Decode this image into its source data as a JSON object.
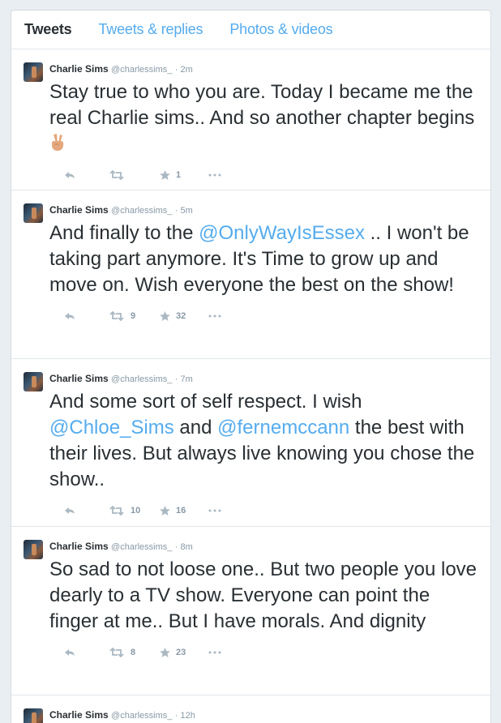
{
  "tabs": {
    "tweets": "Tweets",
    "replies": "Tweets & replies",
    "media": "Photos & videos"
  },
  "tweets": [
    {
      "name": "Charlie Sims",
      "handle": "@charlessims_",
      "time": "· 2m",
      "text": "Stay true to who you are. Today I became me the real Charlie sims.. And so another chapter begins",
      "retweets": "",
      "favorites": "1"
    },
    {
      "name": "Charlie Sims",
      "handle": "@charlessims_",
      "time": "· 5m",
      "text_before": "And finally to the ",
      "mention1": "@OnlyWayIsEssex",
      "text_after": " .. I won't be taking part anymore. It's Time to grow up and move on. Wish everyone the best on the show!",
      "retweets": "9",
      "favorites": "32"
    },
    {
      "name": "Charlie Sims",
      "handle": "@charlessims_",
      "time": "· 7m",
      "text_before": "And some sort of self respect. I wish ",
      "mention1": "@Chloe_Sims",
      "text_middle": " and ",
      "mention2": "@fernemccann",
      "text_after": " the best with their lives. But always live knowing you chose the show..",
      "retweets": "10",
      "favorites": "16"
    },
    {
      "name": "Charlie Sims",
      "handle": "@charlessims_",
      "time": "· 8m",
      "text": "So sad to not loose one.. But two people you love dearly to a TV show. Everyone can point the finger at me.. But I have morals. And dignity",
      "retweets": "8",
      "favorites": "23"
    },
    {
      "name": "Charlie Sims",
      "handle": "@charlessims_",
      "time": "· 12h"
    }
  ],
  "icons": {
    "reply": "reply-icon",
    "retweet": "retweet-icon",
    "favorite": "star-icon",
    "more": "more-icon",
    "emoji": "victory-hand-emoji"
  },
  "colors": {
    "link": "#55acee",
    "text": "#292f33",
    "muted": "#8899a6",
    "background": "#e9eef2"
  }
}
